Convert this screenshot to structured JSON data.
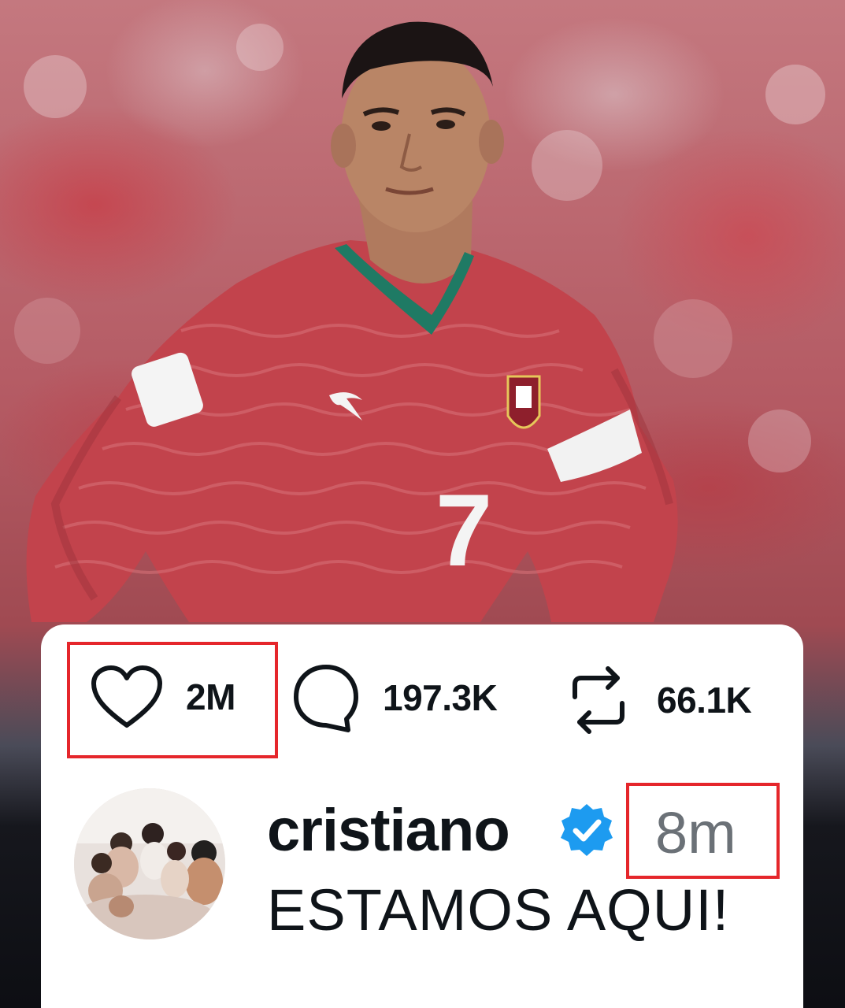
{
  "post": {
    "stats": {
      "likes": "2M",
      "replies": "197.3K",
      "reposts": "66.1K"
    },
    "author": {
      "username": "cristiano",
      "verified": true
    },
    "time": "8m",
    "caption": "ESTAMOS AQUI!"
  },
  "photo": {
    "jersey_number": "7"
  },
  "colors": {
    "highlight": "#e5262b",
    "verified_blue": "#1d9bf0",
    "jersey_red": "#c2434c",
    "text_dark": "#0f1419",
    "text_muted": "#6b7177"
  },
  "icons": [
    "heart-icon",
    "reply-icon",
    "repost-icon",
    "verified-badge-icon"
  ]
}
